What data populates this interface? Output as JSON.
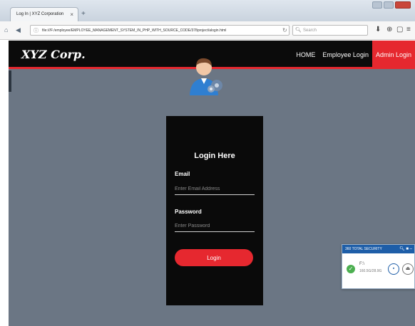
{
  "browser": {
    "tab_title": "Log In | XYZ Corporation",
    "tab_close": "×",
    "new_tab": "+",
    "url": "file:///F:/employee/EMPLOYEE_MANAGEMENT_SYSTEM_IN_PHP_WITH_SOURCE_CODE/378project/alogin.html",
    "search_placeholder": "Search"
  },
  "header": {
    "brand": "XYZ Corp.",
    "menu": [
      {
        "label": "HOME"
      },
      {
        "label": "Employee Login"
      },
      {
        "label": "Admin Login"
      }
    ]
  },
  "login": {
    "title": "Login Here",
    "email_label": "Email",
    "email_placeholder": "Enter Email Address",
    "password_label": "Password",
    "password_placeholder": "Enter Password",
    "button_label": "Login"
  },
  "security_popup": {
    "title": "360 TOTAL SECURITY",
    "drive_label": "F:\\",
    "drive_size": "160.5G/28.9G"
  },
  "colors": {
    "accent": "#e6282f",
    "header_bg": "#0b0b0b",
    "page_bg": "#6b7684",
    "card_bg": "#0a0a0a"
  }
}
